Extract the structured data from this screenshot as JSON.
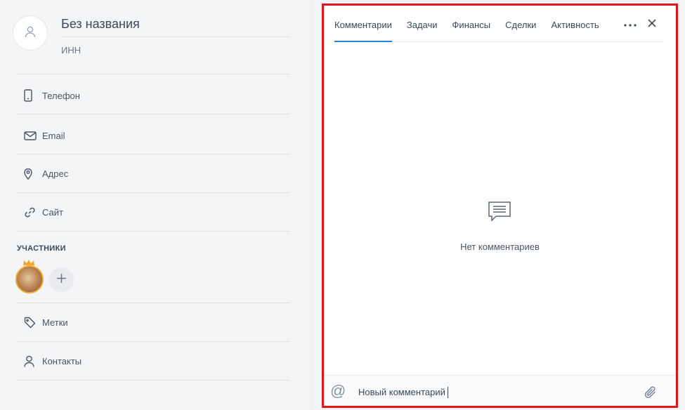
{
  "record": {
    "title": "Без названия",
    "inn_label": "ИНН"
  },
  "fields": [
    {
      "label": "Телефон",
      "icon": "phone-icon"
    },
    {
      "label": "Email",
      "icon": "mail-icon"
    },
    {
      "label": "Адрес",
      "icon": "location-pin-icon"
    },
    {
      "label": "Сайт",
      "icon": "link-icon"
    }
  ],
  "participants": {
    "section_label": "УЧАСТНИКИ"
  },
  "extra_fields": [
    {
      "label": "Метки",
      "icon": "tag-icon"
    },
    {
      "label": "Контакты",
      "icon": "person-icon"
    }
  ],
  "tabs": [
    {
      "label": "Комментарии",
      "active": true
    },
    {
      "label": "Задачи",
      "active": false
    },
    {
      "label": "Финансы",
      "active": false
    },
    {
      "label": "Сделки",
      "active": false
    },
    {
      "label": "Активность",
      "active": false
    }
  ],
  "comments": {
    "empty_text": "Нет комментариев",
    "input_value": "Новый комментарий"
  },
  "colors": {
    "accent": "#2f7fd8",
    "highlight_frame": "#e0161b",
    "crown": "#f0a830"
  }
}
